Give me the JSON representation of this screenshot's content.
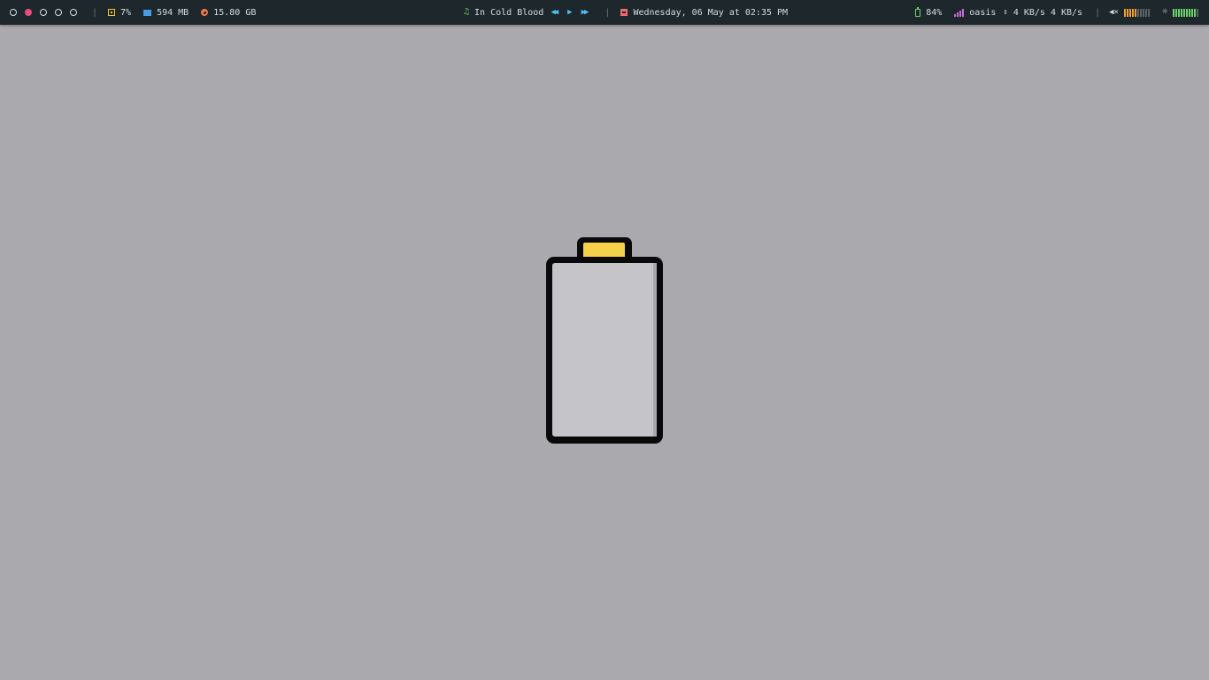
{
  "topbar": {
    "workspaces": [
      {
        "active": false
      },
      {
        "active": true
      },
      {
        "active": false
      },
      {
        "active": false
      },
      {
        "active": false
      }
    ],
    "separator": "|",
    "cpu": {
      "icon": "cpu-icon",
      "value": "7%"
    },
    "memory": {
      "icon": "memory-icon",
      "value": "594 MB"
    },
    "disk": {
      "icon": "disk-icon",
      "value": "15.80 GB"
    },
    "music": {
      "icon": "music-note-icon",
      "track": "In Cold Blood"
    },
    "date": {
      "icon": "calendar-icon",
      "text": "Wednesday, 06 May at 02:35 PM"
    },
    "battery": {
      "icon": "battery-icon",
      "value": "84%"
    },
    "network": {
      "icon": "wifi-icon",
      "ssid": "oasis",
      "speed": "4 KB/s 4 KB/s"
    },
    "volume": {
      "icon": "volume-icon",
      "level": 0.35
    },
    "brightness": {
      "icon": "brightness-icon",
      "level": 0.9
    }
  },
  "colors": {
    "bar_bg": "#1e272b",
    "desktop_bg": "#aaa9ae",
    "accent_active": "#ec4c7f",
    "battery_cap": "#f5d04a",
    "battery_body": "#c5c4c9"
  },
  "battery_graphic": {
    "icon": "battery-empty-icon"
  }
}
